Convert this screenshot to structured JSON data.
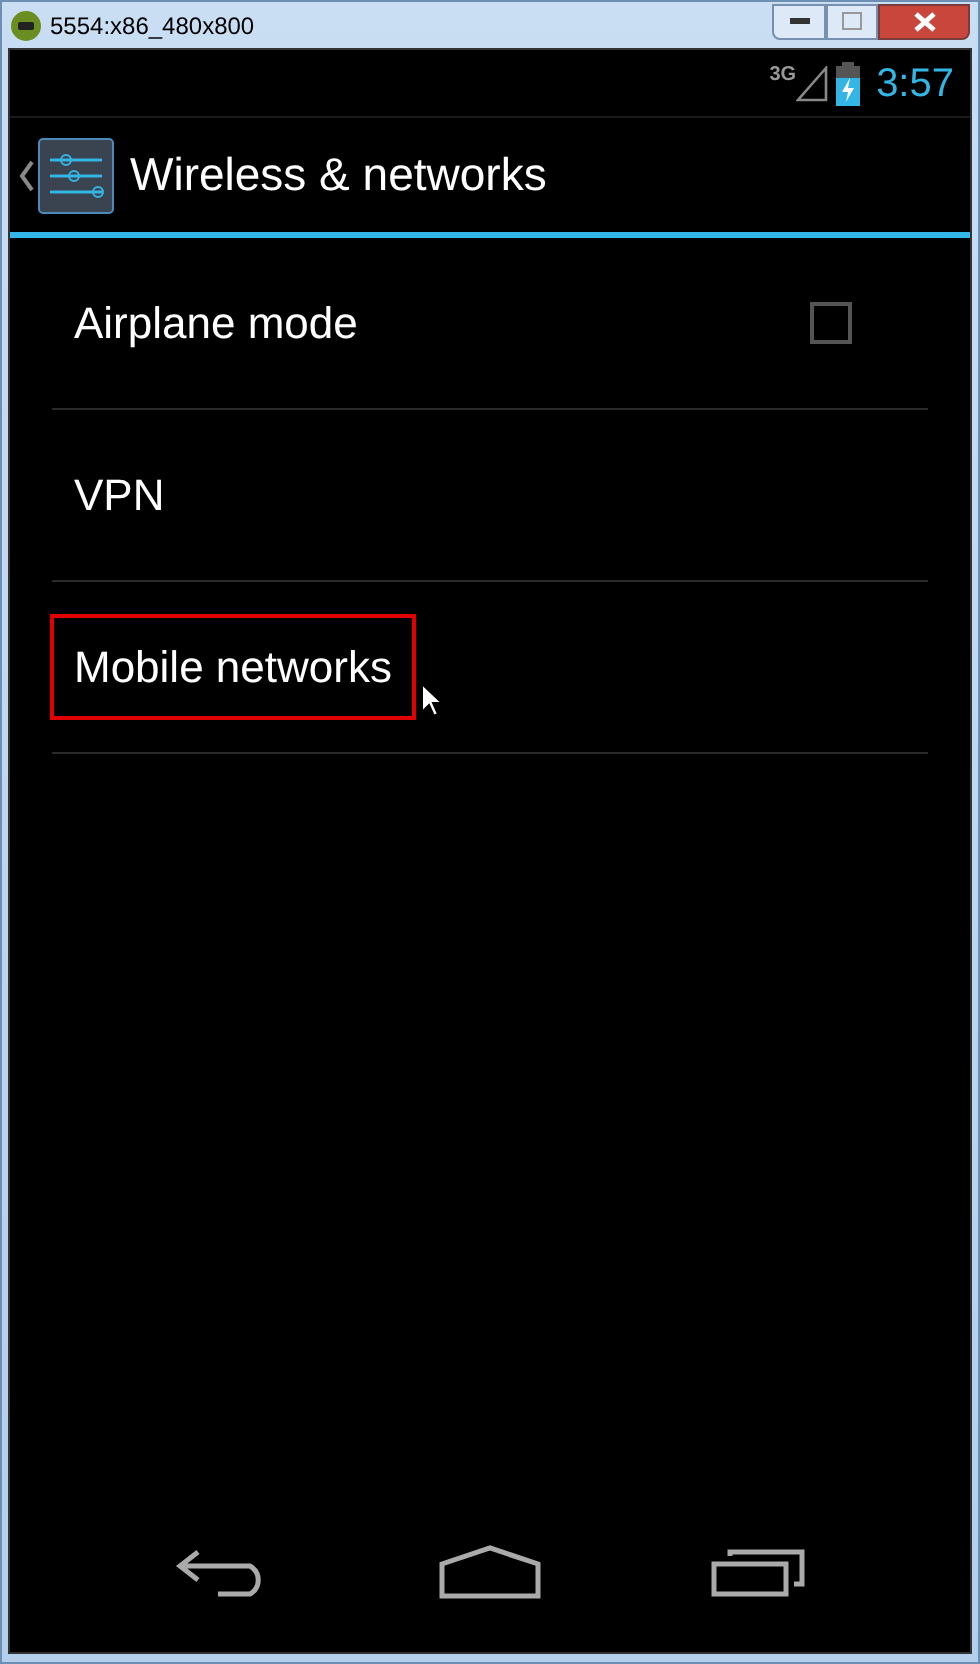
{
  "window": {
    "title": "5554:x86_480x800"
  },
  "status_bar": {
    "network": "3G",
    "time": "3:57"
  },
  "action_bar": {
    "title": "Wireless & networks"
  },
  "items": [
    {
      "label": "Airplane mode",
      "kind": "checkbox",
      "checked": false,
      "highlighted": false
    },
    {
      "label": "VPN",
      "kind": "link",
      "highlighted": false
    },
    {
      "label": "Mobile networks",
      "kind": "link",
      "highlighted": true
    }
  ]
}
